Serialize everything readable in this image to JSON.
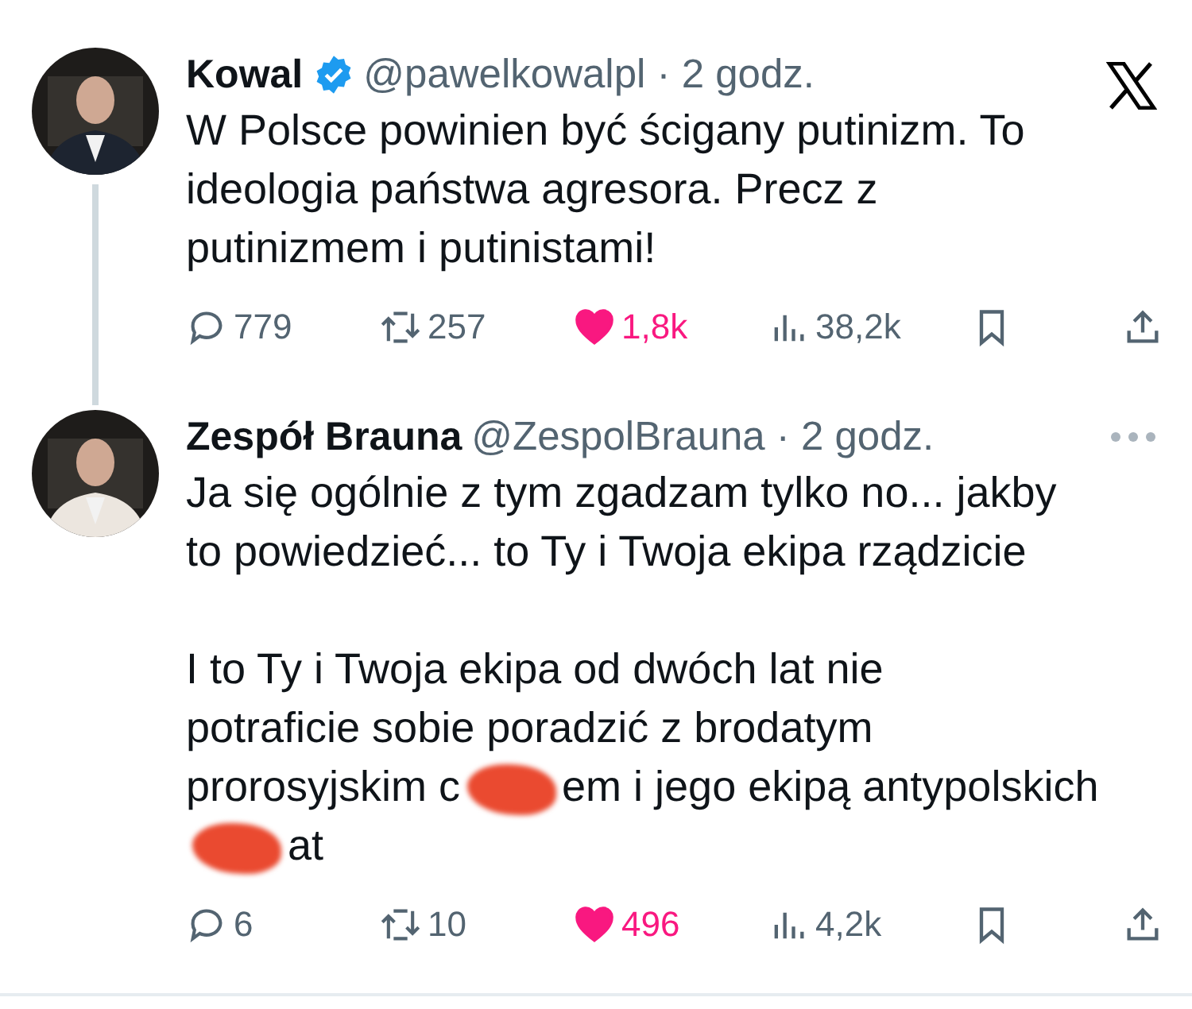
{
  "tweets": [
    {
      "author": "Kowal",
      "verified": true,
      "handle": "@pawelkowalpl",
      "separator": "·",
      "time": "2 godz.",
      "thread_line": true,
      "body": [
        [
          [
            {
              "kind": "text",
              "text": "W Polsce powinien być ścigany putinizm. To"
            }
          ],
          [
            {
              "kind": "text",
              "text": "ideologia państwa agresora. Precz z"
            }
          ],
          [
            {
              "kind": "text",
              "text": "putinizmem i putinistami!"
            }
          ]
        ]
      ],
      "stats": {
        "replies": "779",
        "reposts": "257",
        "likes": "1,8k",
        "views": "38,2k"
      },
      "liked": true
    },
    {
      "author": "Zespół Brauna",
      "handle": "@ZespolBrauna",
      "separator": "·",
      "time": "2 godz.",
      "body": [
        [
          [
            {
              "kind": "text",
              "text": "Ja się ogólnie z tym zgadzam tylko no... jakby"
            }
          ],
          [
            {
              "kind": "text",
              "text": "to powiedzieć... to Ty i Twoja ekipa rządzicie"
            }
          ]
        ],
        [
          [
            {
              "kind": "text",
              "text": "I to Ty i Twoja ekipa od dwóch lat nie"
            }
          ],
          [
            {
              "kind": "text",
              "text": "potraficie sobie poradzić z brodatym"
            }
          ],
          [
            {
              "kind": "text",
              "text": "prorosyjskim c"
            },
            {
              "kind": "redaction"
            },
            {
              "kind": "text",
              "text": "em i jego ekipą antypolskich"
            }
          ],
          [
            {
              "kind": "redaction"
            },
            {
              "kind": "text",
              "text": "at"
            }
          ]
        ]
      ],
      "stats": {
        "replies": "6",
        "reposts": "10",
        "likes": "496",
        "views": "4,2k"
      },
      "liked": true
    }
  ]
}
